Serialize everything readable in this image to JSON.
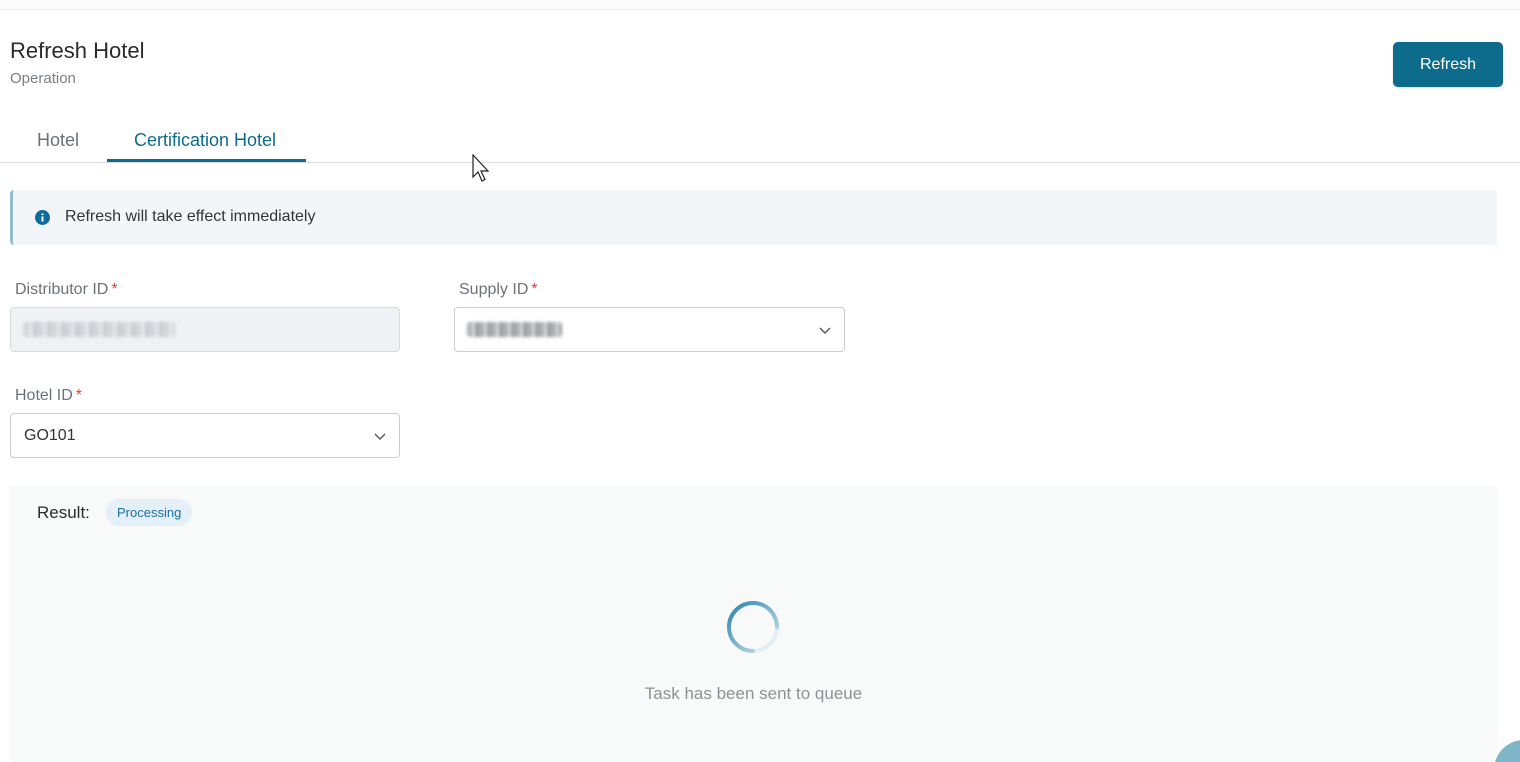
{
  "header": {
    "title": "Refresh Hotel",
    "subtitle": "Operation",
    "refresh_label": "Refresh"
  },
  "tabs": [
    {
      "label": "Hotel",
      "active": false
    },
    {
      "label": "Certification Hotel",
      "active": true
    }
  ],
  "alert": {
    "icon": "info-icon",
    "text": "Refresh will take effect immediately"
  },
  "form": {
    "distributor_id": {
      "label": "Distributor ID",
      "required": "*",
      "value": ""
    },
    "supply_id": {
      "label": "Supply ID",
      "required": "*",
      "value": ""
    },
    "hotel_id": {
      "label": "Hotel ID",
      "required": "*",
      "value": "GO101"
    }
  },
  "result": {
    "label": "Result:",
    "status": "Processing",
    "message": "Task has been sent to queue"
  },
  "colors": {
    "primary": "#0d6b8c",
    "badge_bg": "#e4eff7",
    "badge_text": "#1a6fa5",
    "required": "#e0413a"
  }
}
